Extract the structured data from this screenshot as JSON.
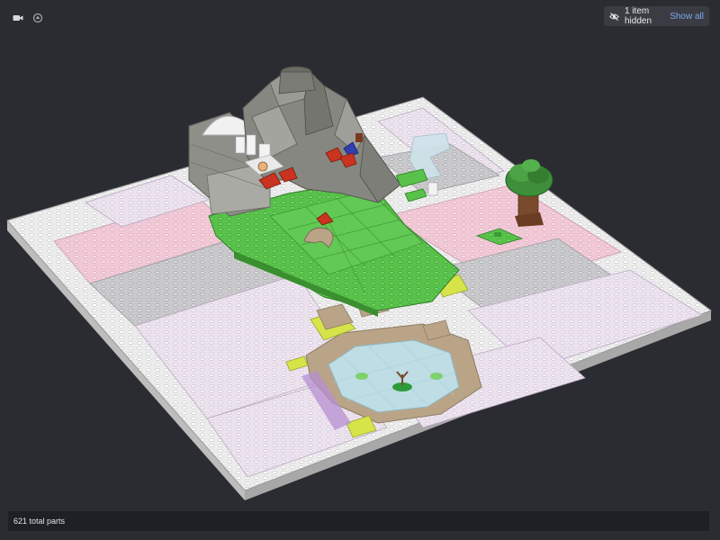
{
  "toolbar": {
    "camera_icon": "camera-icon",
    "reset_icon": "rotate-reset-icon"
  },
  "visibility": {
    "hidden_label": "1 item hidden",
    "show_all_label": "Show all",
    "icon": "eye-off-icon"
  },
  "status": {
    "total_parts": "621 total parts"
  },
  "colors": {
    "background": "#2b2c32",
    "baseplate_white": "#eeeeee",
    "plate_pink": "#f2c8d6",
    "plate_lavender": "#ebe2ee",
    "plate_gray": "#c9c9cc",
    "grass_green": "#58c24a",
    "rock_gray": "#8d8e88",
    "water_blue": "#bfe1ea",
    "sand_tan": "#b9a488",
    "lime": "#d6e44a",
    "tree_green": "#3f8f3a",
    "tree_trunk": "#7a4a2c",
    "accent_link": "#7aa9ee"
  }
}
